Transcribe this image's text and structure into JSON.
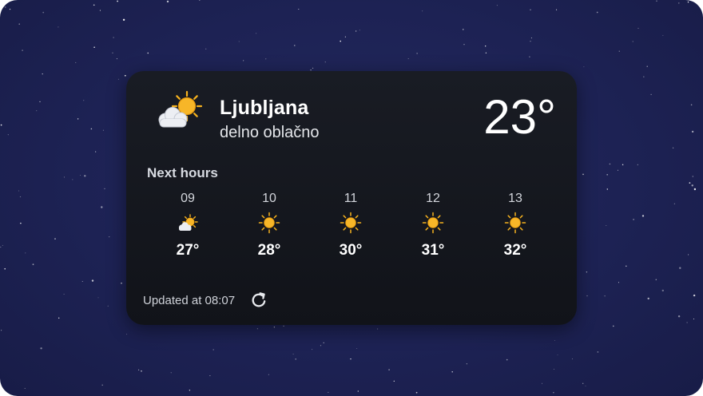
{
  "widget": {
    "city": "Ljubljana",
    "condition": "delno oblačno",
    "current_temp": "23°",
    "current_icon": "partly-cloudy-icon",
    "section_title": "Next hours",
    "updated_text": "Updated at 08:07",
    "refresh_icon": "refresh-icon"
  },
  "hourly": [
    {
      "hour": "09",
      "temp": "27°",
      "icon": "partly-cloudy-icon"
    },
    {
      "hour": "10",
      "temp": "28°",
      "icon": "sun-icon"
    },
    {
      "hour": "11",
      "temp": "30°",
      "icon": "sun-icon"
    },
    {
      "hour": "12",
      "temp": "31°",
      "icon": "sun-icon"
    },
    {
      "hour": "13",
      "temp": "32°",
      "icon": "sun-icon"
    }
  ],
  "colors": {
    "background": "#1d2254",
    "card": "#15171e",
    "sun": "#f6b21e",
    "cloud": "#e6e8ee"
  }
}
